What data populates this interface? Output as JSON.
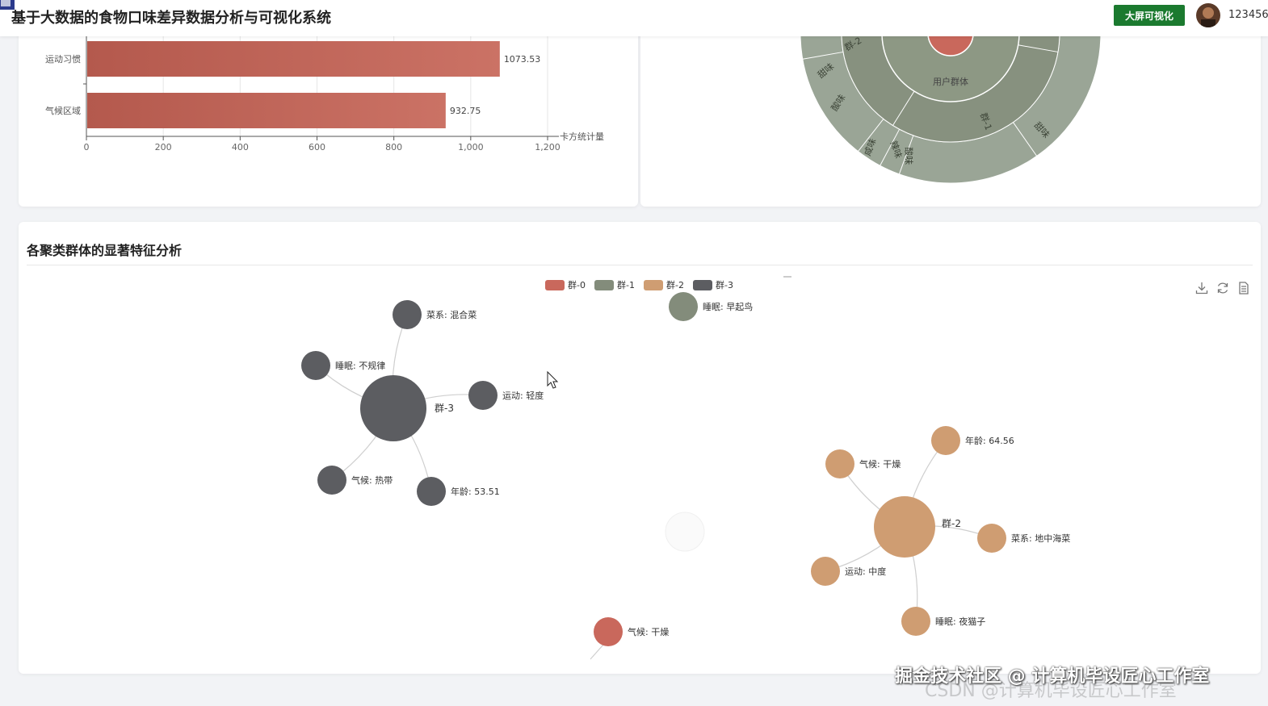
{
  "header": {
    "title": "基于大数据的食物口味差异数据分析与可视化系统",
    "big_screen_button": "大屏可视化",
    "username": "123456"
  },
  "bar_chart": {
    "chart_data": {
      "type": "bar",
      "orientation": "horizontal",
      "categories": [
        "运动习惯",
        "气候区域"
      ],
      "values": [
        1073.53,
        932.75
      ],
      "data_labels": [
        "1073.53",
        "932.75"
      ],
      "xlabel": "卡方统计量",
      "ylabel": "",
      "xlim": [
        0,
        1200
      ],
      "x_ticks": [
        "0",
        "200",
        "400",
        "600",
        "800",
        "1,000",
        "1,200"
      ],
      "bar_color": "#c0675a",
      "grid": true
    }
  },
  "sunburst": {
    "chart_data": {
      "type": "sunburst",
      "root_label": "用户群体",
      "ring_labels": [
        "咸味",
        "辣味",
        "甜味",
        "群-1",
        "酸味",
        "辣味",
        "咸味",
        "酸味",
        "甜味",
        "群-2",
        "咸味"
      ],
      "colors": {
        "center": "#c9685c",
        "inner": "#87917f",
        "outer": "#9aa596"
      }
    }
  },
  "cluster_section": {
    "title": "各聚类群体的显著特征分析"
  },
  "cluster_graph": {
    "chart_data": {
      "type": "graph",
      "legend": [
        {
          "name": "群-0",
          "color": "#c9685c"
        },
        {
          "name": "群-1",
          "color": "#838c7b"
        },
        {
          "name": "群-2",
          "color": "#cf9d72"
        },
        {
          "name": "群-3",
          "color": "#5c5d61"
        }
      ],
      "hubs": [
        "群-3",
        "群-2"
      ],
      "nodes": [
        {
          "label": "群-3",
          "group": "群-3"
        },
        {
          "label": "菜系: 混合菜",
          "group": "群-3"
        },
        {
          "label": "睡眠: 不规律",
          "group": "群-3"
        },
        {
          "label": "运动: 轻度",
          "group": "群-3"
        },
        {
          "label": "气候: 热带",
          "group": "群-3"
        },
        {
          "label": "年龄: 53.51",
          "group": "群-3"
        },
        {
          "label": "睡眠: 早起鸟",
          "group": "群-1"
        },
        {
          "label": "群-2",
          "group": "群-2"
        },
        {
          "label": "年龄: 64.56",
          "group": "群-2"
        },
        {
          "label": "气候: 干燥",
          "group": "群-2"
        },
        {
          "label": "菜系: 地中海菜",
          "group": "群-2"
        },
        {
          "label": "运动: 中度",
          "group": "群-2"
        },
        {
          "label": "睡眠: 夜猫子",
          "group": "群-2"
        },
        {
          "label": "气候: 干燥",
          "group": "群-0"
        }
      ],
      "links": [
        [
          "群-3",
          "菜系: 混合菜"
        ],
        [
          "群-3",
          "睡眠: 不规律"
        ],
        [
          "群-3",
          "运动: 轻度"
        ],
        [
          "群-3",
          "气候: 热带"
        ],
        [
          "群-3",
          "年龄: 53.51"
        ],
        [
          "群-2",
          "年龄: 64.56"
        ],
        [
          "群-2",
          "气候: 干燥"
        ],
        [
          "群-2",
          "菜系: 地中海菜"
        ],
        [
          "群-2",
          "运动: 中度"
        ],
        [
          "群-2",
          "睡眠: 夜猫子"
        ]
      ]
    }
  },
  "toolbox": {
    "icons": [
      "download-icon",
      "refresh-icon",
      "data-view-icon"
    ]
  },
  "watermark": {
    "line1": "掘金技术社区 @ 计算机毕设匠心工作室",
    "line2": "CSDN @计算机毕设匠心工作室"
  }
}
